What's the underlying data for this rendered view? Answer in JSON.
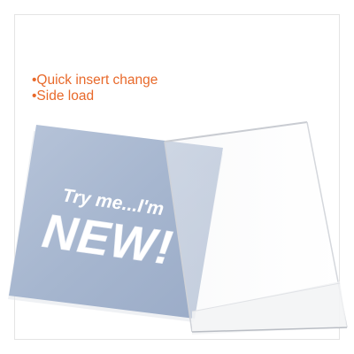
{
  "features": [
    "•Quick insert change",
    "•Side load"
  ],
  "insert_card": {
    "line1": "Try me...I'm",
    "line2": "NEW!"
  },
  "colors": {
    "accent": "#e8692a",
    "card": "#a9b8d1",
    "background": "#ffffff"
  }
}
